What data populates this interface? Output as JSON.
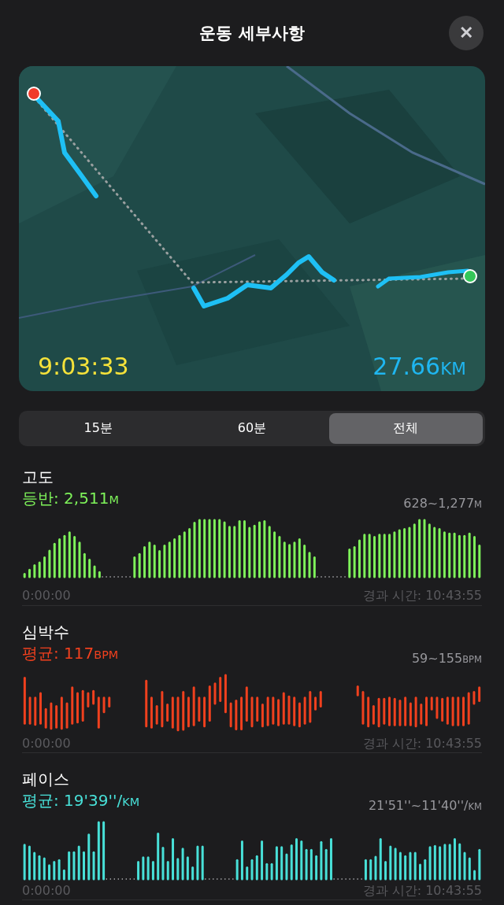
{
  "header": {
    "title": "운동 세부사항",
    "close_button": "✕"
  },
  "map": {
    "kind": "picture",
    "duration": "9:03:33",
    "distance": "27.66",
    "distance_unit": "KM"
  },
  "tabs": [
    {
      "label": "15분",
      "selected": false
    },
    {
      "label": "60분",
      "selected": false
    },
    {
      "label": "전체",
      "selected": true
    }
  ],
  "metrics": [
    {
      "kind": "elevation",
      "title": "고도",
      "summary_label": "등반: ",
      "summary_value": "2,511",
      "summary_unit": "M",
      "range_value": "628~1,277",
      "range_unit": "M",
      "color": "#7ef25a",
      "start_time": "0:00:00",
      "elapsed": "경과 시간: 10:43:55"
    },
    {
      "kind": "heart",
      "title": "심박수",
      "summary_label": "평균: ",
      "summary_value": "117",
      "summary_unit": "BPM",
      "range_value": "59~155",
      "range_unit": "BPM",
      "color": "#f0401e",
      "start_time": "0:00:00",
      "elapsed": "경과 시간: 10:43:55"
    },
    {
      "kind": "pace",
      "title": "페이스",
      "summary_label": "평균: ",
      "summary_value": "19'39''/",
      "summary_unit": "KM",
      "range_value": "21'51''~11'40''/",
      "range_unit": "KM",
      "color": "#48e0d8",
      "start_time": "0:00:00",
      "elapsed": "경과 시간: 10:43:55"
    }
  ]
}
